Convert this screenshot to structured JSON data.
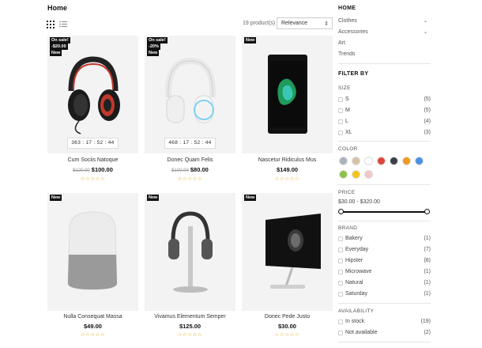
{
  "breadcrumb": "Home",
  "toolbar": {
    "product_count": "19 product(s)",
    "sort_value": "Relevance",
    "sort_caret": "⇕"
  },
  "products": [
    {
      "name": "Cum Sociis Natoque",
      "old_price": "$120.00",
      "price": "$100.00",
      "badges": [
        "On sale!",
        "-$20.00",
        "New"
      ],
      "timer": "363 : 17 : 52 : 44",
      "stars": "☆☆☆☆☆"
    },
    {
      "name": "Donec Quam Felis",
      "old_price": "$100.00",
      "price": "$80.00",
      "badges": [
        "On sale!",
        "-20%",
        "New"
      ],
      "timer": "468 : 17 : 52 : 44",
      "stars": "☆☆☆☆☆"
    },
    {
      "name": "Nascetur Ridiculus Mus",
      "old_price": "",
      "price": "$149.00",
      "badges": [
        "New"
      ],
      "timer": "",
      "stars": "☆☆☆☆☆"
    },
    {
      "name": "Nulla Consequat Massa",
      "old_price": "",
      "price": "$49.00",
      "badges": [
        "New"
      ],
      "timer": "",
      "stars": "☆☆☆☆☆"
    },
    {
      "name": "Vivamus Elementum Semper",
      "old_price": "",
      "price": "$125.00",
      "badges": [
        "New"
      ],
      "timer": "",
      "stars": "☆☆☆☆☆"
    },
    {
      "name": "Donec Pede Justo",
      "old_price": "",
      "price": "$30.00",
      "badges": [
        "New"
      ],
      "timer": "",
      "stars": "☆☆☆☆☆"
    }
  ],
  "sidebar": {
    "home_title": "HOME",
    "categories": [
      {
        "label": "Clothes",
        "expandable": true
      },
      {
        "label": "Accessories",
        "expandable": true
      },
      {
        "label": "Art",
        "expandable": false
      },
      {
        "label": "Trends",
        "expandable": false
      }
    ],
    "filter_title": "FILTER BY",
    "size": {
      "title": "SIZE",
      "options": [
        {
          "label": "S",
          "count": "(5)"
        },
        {
          "label": "M",
          "count": "(5)"
        },
        {
          "label": "L",
          "count": "(4)"
        },
        {
          "label": "XL",
          "count": "(3)"
        }
      ]
    },
    "color": {
      "title": "COLOR",
      "swatches": [
        "#a9b2bf",
        "#d7c3a4",
        "#ffffff",
        "#e0453b",
        "#3a3f4a",
        "#ef9a1b",
        "#4a90e2",
        "#8bc34a",
        "#f5c518",
        "#f6c6c6"
      ]
    },
    "price": {
      "title": "PRICE",
      "range": "$30.00 - $320.00"
    },
    "brand": {
      "title": "BRAND",
      "options": [
        {
          "label": "Bakery",
          "count": "(1)"
        },
        {
          "label": "Everyday",
          "count": "(7)"
        },
        {
          "label": "Hipster",
          "count": "(8)"
        },
        {
          "label": "Microwave",
          "count": "(1)"
        },
        {
          "label": "Natural",
          "count": "(1)"
        },
        {
          "label": "Saturday",
          "count": "(1)"
        }
      ]
    },
    "availability": {
      "title": "AVAILABILITY",
      "options": [
        {
          "label": "In stock",
          "count": "(19)"
        },
        {
          "label": "Not available",
          "count": "(2)"
        }
      ]
    }
  },
  "chevron": "⌄"
}
